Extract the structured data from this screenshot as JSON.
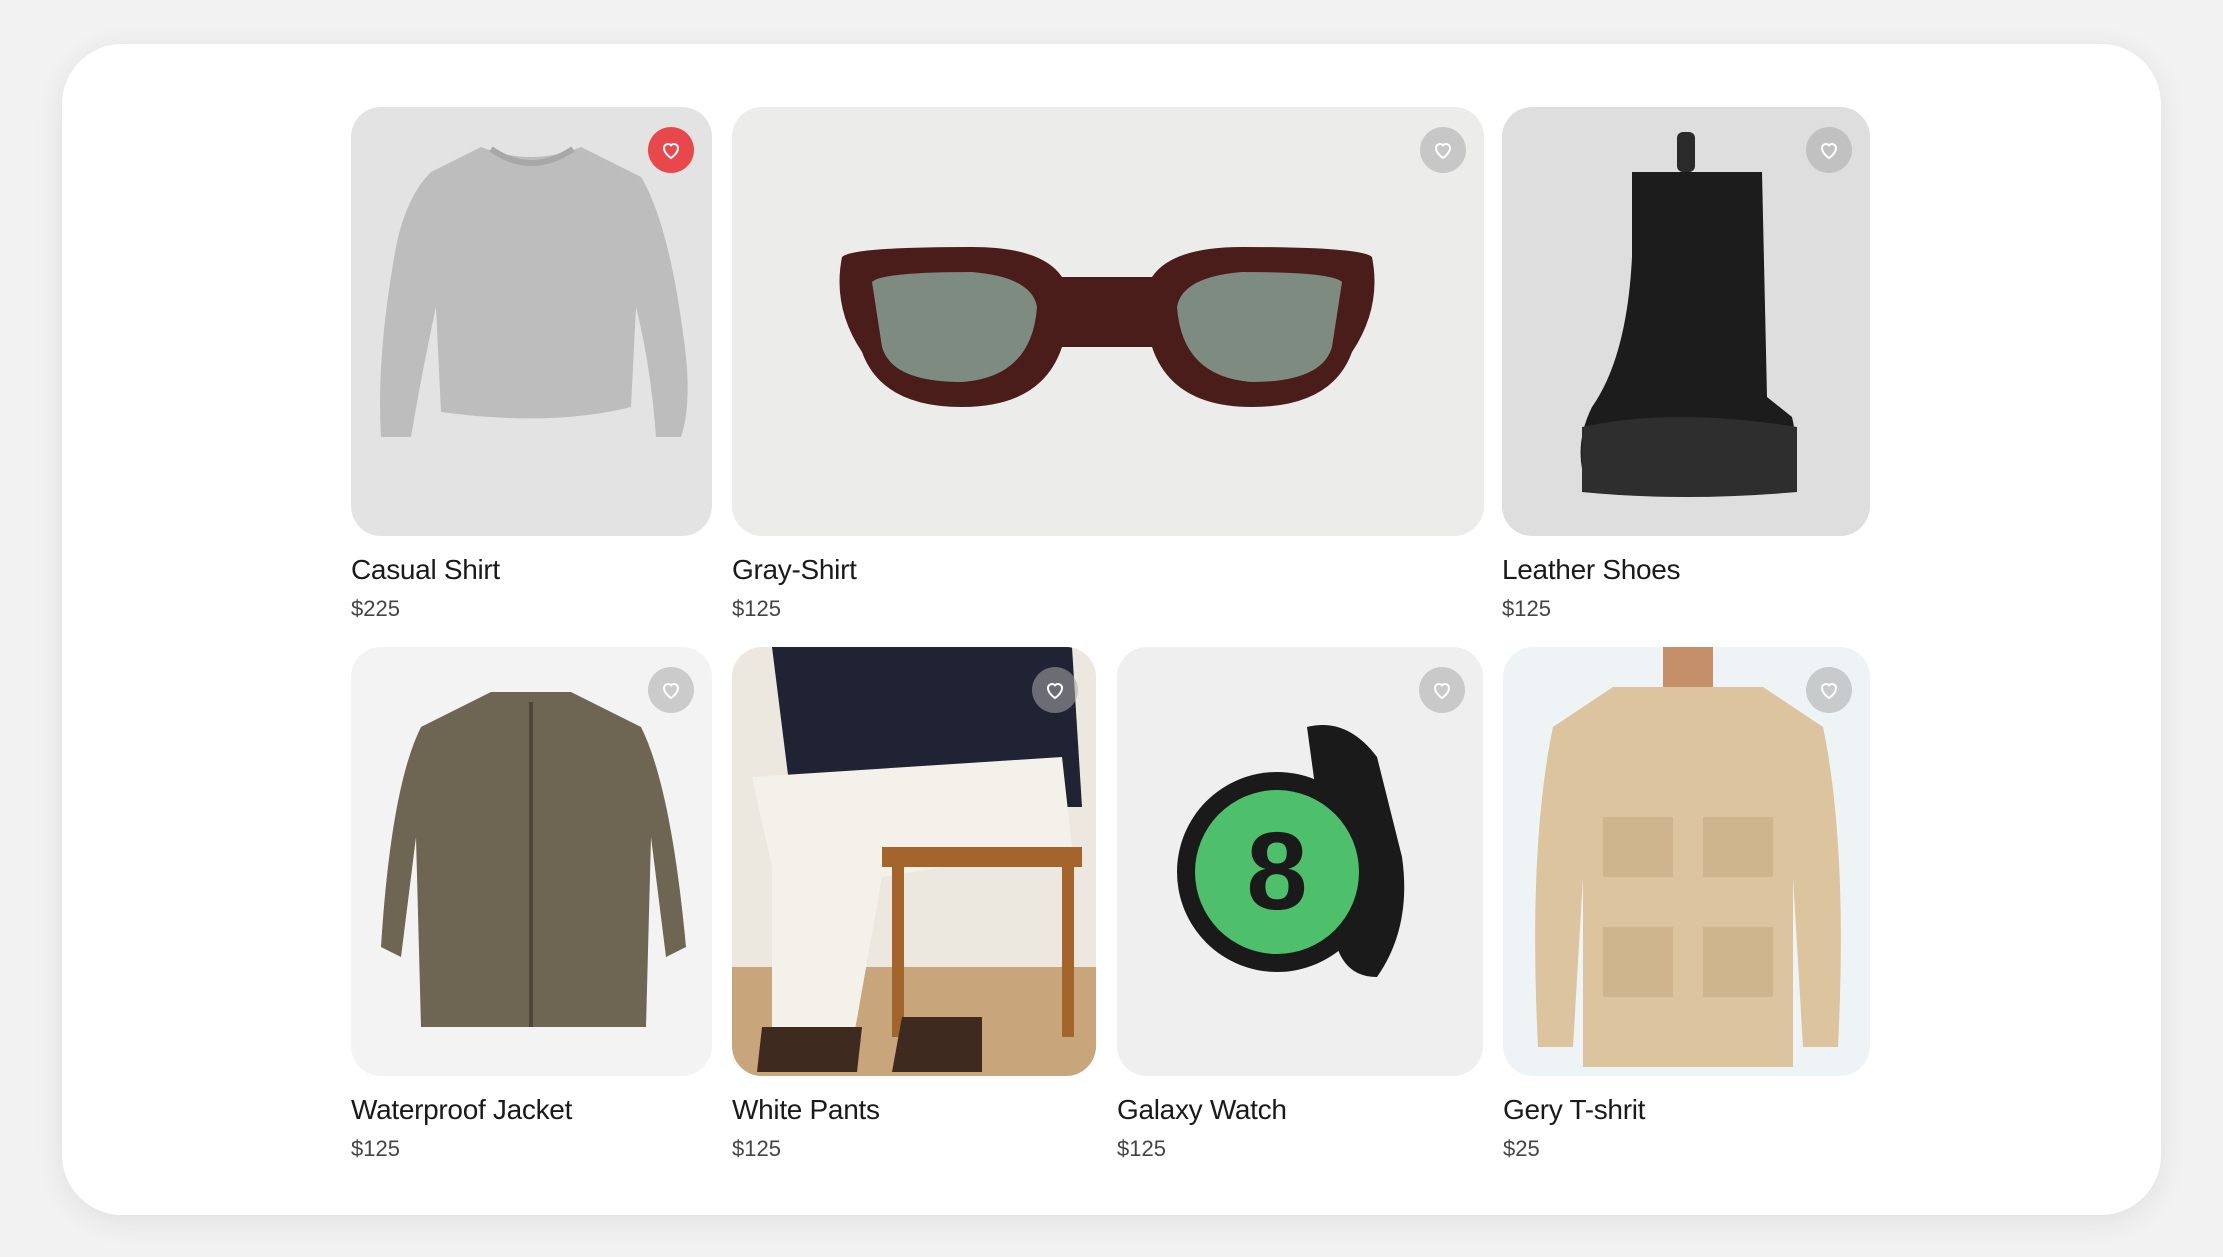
{
  "products": [
    {
      "name": "Casual Shirt",
      "price": "$225",
      "favorited": true,
      "icon": "sweater-icon",
      "bg": "#e3e3e3"
    },
    {
      "name": "Gray-Shirt",
      "price": "$125",
      "favorited": false,
      "icon": "sunglasses-icon",
      "bg": "#ececea"
    },
    {
      "name": "Leather Shoes",
      "price": "$125",
      "favorited": false,
      "icon": "boot-icon",
      "bg": "#dedede"
    },
    {
      "name": "Waterproof Jacket",
      "price": "$125",
      "favorited": false,
      "icon": "jacket-icon",
      "bg": "#f3f3f3"
    },
    {
      "name": "White Pants",
      "price": "$125",
      "favorited": false,
      "icon": "person-pants-icon",
      "bg": "#ece7df"
    },
    {
      "name": "Galaxy Watch",
      "price": "$125",
      "favorited": false,
      "icon": "smartwatch-icon",
      "bg": "#efefef"
    },
    {
      "name": "Gery T-shrit",
      "price": "$25",
      "favorited": false,
      "icon": "utility-jacket-icon",
      "bg": "#eef4f6"
    }
  ],
  "colors": {
    "favorite_active": "#e8474b",
    "favorite_idle": "#aaaaaa"
  }
}
